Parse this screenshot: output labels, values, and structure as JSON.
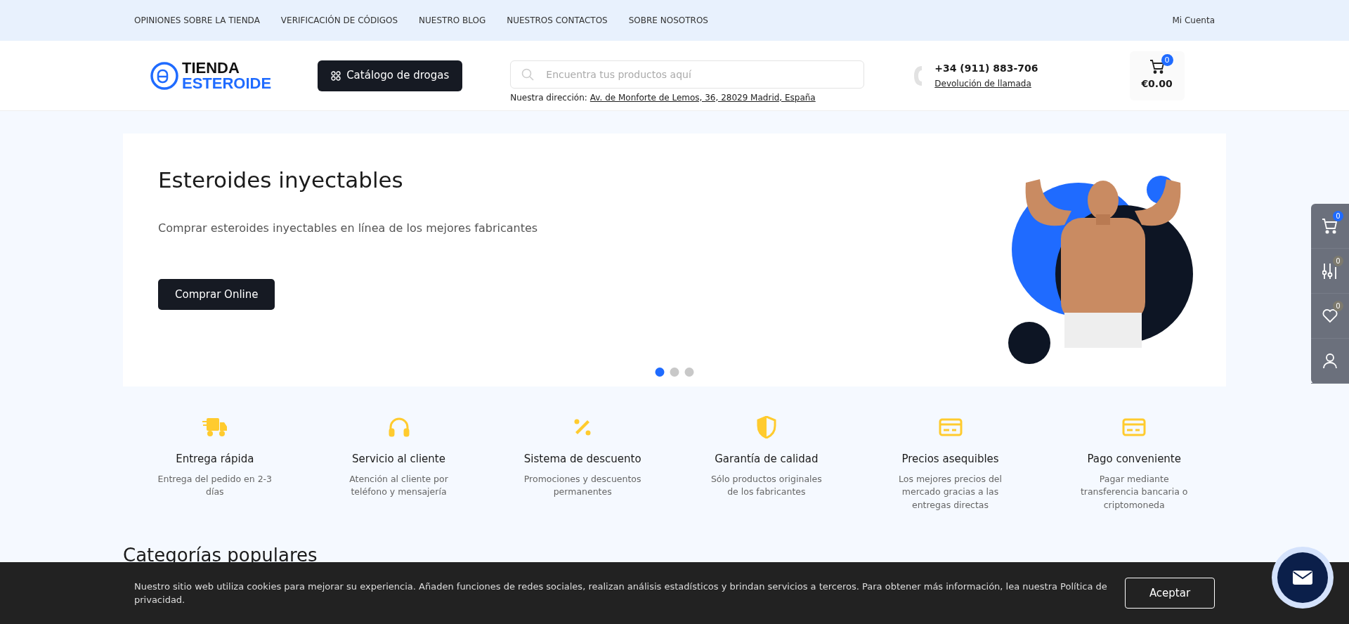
{
  "top_nav": {
    "links": [
      "OPINIONES SOBRE LA TIENDA",
      "VERIFICACIÓN DE CÓDIGOS",
      "NUESTRO BLOG",
      "NUESTROS CONTACTOS",
      "SOBRE NOSOTROS"
    ],
    "account": "Mi Cuenta"
  },
  "header": {
    "logo": {
      "line_1": "TIENDA",
      "line_2": "ESTEROIDE"
    },
    "catalog_button": "Catálogo de drogas",
    "search": {
      "placeholder": "Encuentra tus productos aquí"
    },
    "address": {
      "label": "Nuestra dirección:",
      "link": "Av. de Monforte de Lemos, 36, 28029 Madrid, España"
    },
    "phone": "+34 (911) 883-706",
    "callback": "Devolución de llamada",
    "cart": {
      "count": "0",
      "total": "€0.00"
    }
  },
  "hero": {
    "title": "Esteroides inyectables",
    "subtitle": "Comprar esteroides inyectables en línea de los mejores fabricantes",
    "button": "Comprar Online",
    "dots": [
      {
        "selected": true
      },
      {
        "selected": false
      },
      {
        "selected": false
      }
    ]
  },
  "side_panel": [
    {
      "kind": "cart",
      "count": "0"
    },
    {
      "kind": "compare",
      "count": "0"
    },
    {
      "kind": "wishlist",
      "count": "0"
    },
    {
      "kind": "account"
    }
  ],
  "features": [
    {
      "kind": "truck",
      "title": "Entrega rápida",
      "text": "Entrega del pedido en 2-3 días"
    },
    {
      "kind": "headphones",
      "title": "Servicio al cliente",
      "text": "Atención al cliente por teléfono y mensajería"
    },
    {
      "kind": "percent",
      "title": "Sistema de descuento",
      "text": "Promociones y descuentos permanentes"
    },
    {
      "kind": "shield",
      "title": "Garantía de calidad",
      "text": "Sólo productos originales de los fabricantes"
    },
    {
      "kind": "card",
      "title": "Precios asequibles",
      "text": "Los mejores precios del mercado gracias a las entregas directas"
    },
    {
      "kind": "card",
      "title": "Pago conveniente",
      "text": "Pagar mediante transferencia bancaria o criptomoneda"
    }
  ],
  "section_title": "Categorías populares",
  "cookie_bar": {
    "text": "Nuestro sitio web utiliza cookies para mejorar su experiencia. Añaden funciones de redes sociales, realizan análisis estadísticos y brindan servicios a terceros. Para obtener más información, lea nuestra Política de privacidad.",
    "button": "Aceptar"
  }
}
